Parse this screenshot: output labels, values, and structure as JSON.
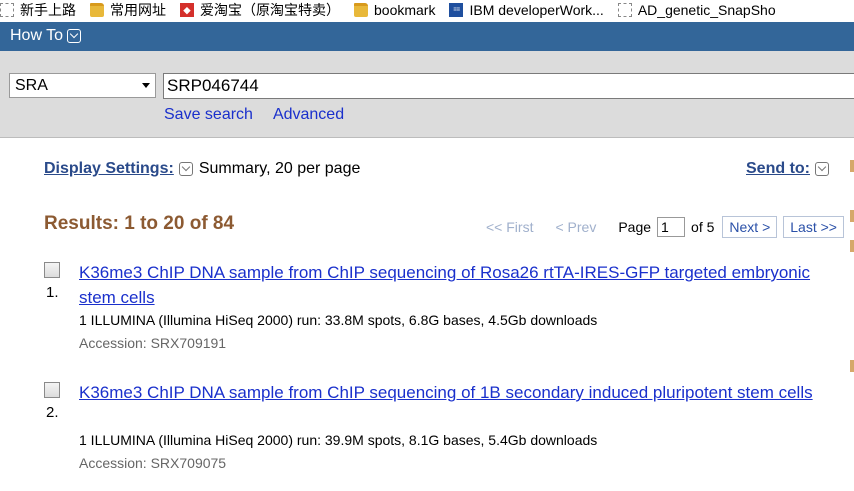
{
  "bookmarks": [
    {
      "icon": "page-icon",
      "label": "新手上路"
    },
    {
      "icon": "folder-icon",
      "label": "常用网址"
    },
    {
      "icon": "taobao-icon",
      "label": "爱淘宝（原淘宝特卖）"
    },
    {
      "icon": "folder-icon",
      "label": "bookmark"
    },
    {
      "icon": "ibm-icon",
      "label": "IBM developerWork..."
    },
    {
      "icon": "page-icon",
      "label": "AD_genetic_SnapSho"
    }
  ],
  "howto": {
    "label": "How To"
  },
  "search": {
    "database": "SRA",
    "query": "SRP046744",
    "save_search": "Save search",
    "advanced": "Advanced"
  },
  "display": {
    "settings_label": "Display Settings:",
    "settings_value": "Summary, 20 per page",
    "send_to": "Send to:"
  },
  "results": {
    "title": "Results: 1 to 20 of 84",
    "pager": {
      "first": "<< First",
      "prev": "< Prev",
      "page_label": "Page",
      "page_value": "1",
      "of_label": "of 5",
      "next": "Next >",
      "last": "Last >>"
    },
    "items": [
      {
        "number": "1.",
        "title": "K36me3 ChIP DNA sample from ChIP sequencing of Rosa26 rtTA-IRES-GFP targeted embryonic stem cells",
        "description": "1 ILLUMINA (Illumina HiSeq 2000) run: 33.8M spots, 6.8G bases, 4.5Gb downloads",
        "accession": "Accession: SRX709191"
      },
      {
        "number": "2.",
        "title": "K36me3 ChIP DNA sample from ChIP sequencing of 1B secondary induced pluripotent stem cells",
        "description": "1 ILLUMINA (Illumina HiSeq 2000) run: 39.9M spots, 8.1G bases, 5.4Gb downloads",
        "accession": "Accession: SRX709075"
      }
    ]
  },
  "colors": {
    "header_blue": "#336699",
    "link_blue": "#1a30cc",
    "results_brown": "#8c5a32"
  }
}
